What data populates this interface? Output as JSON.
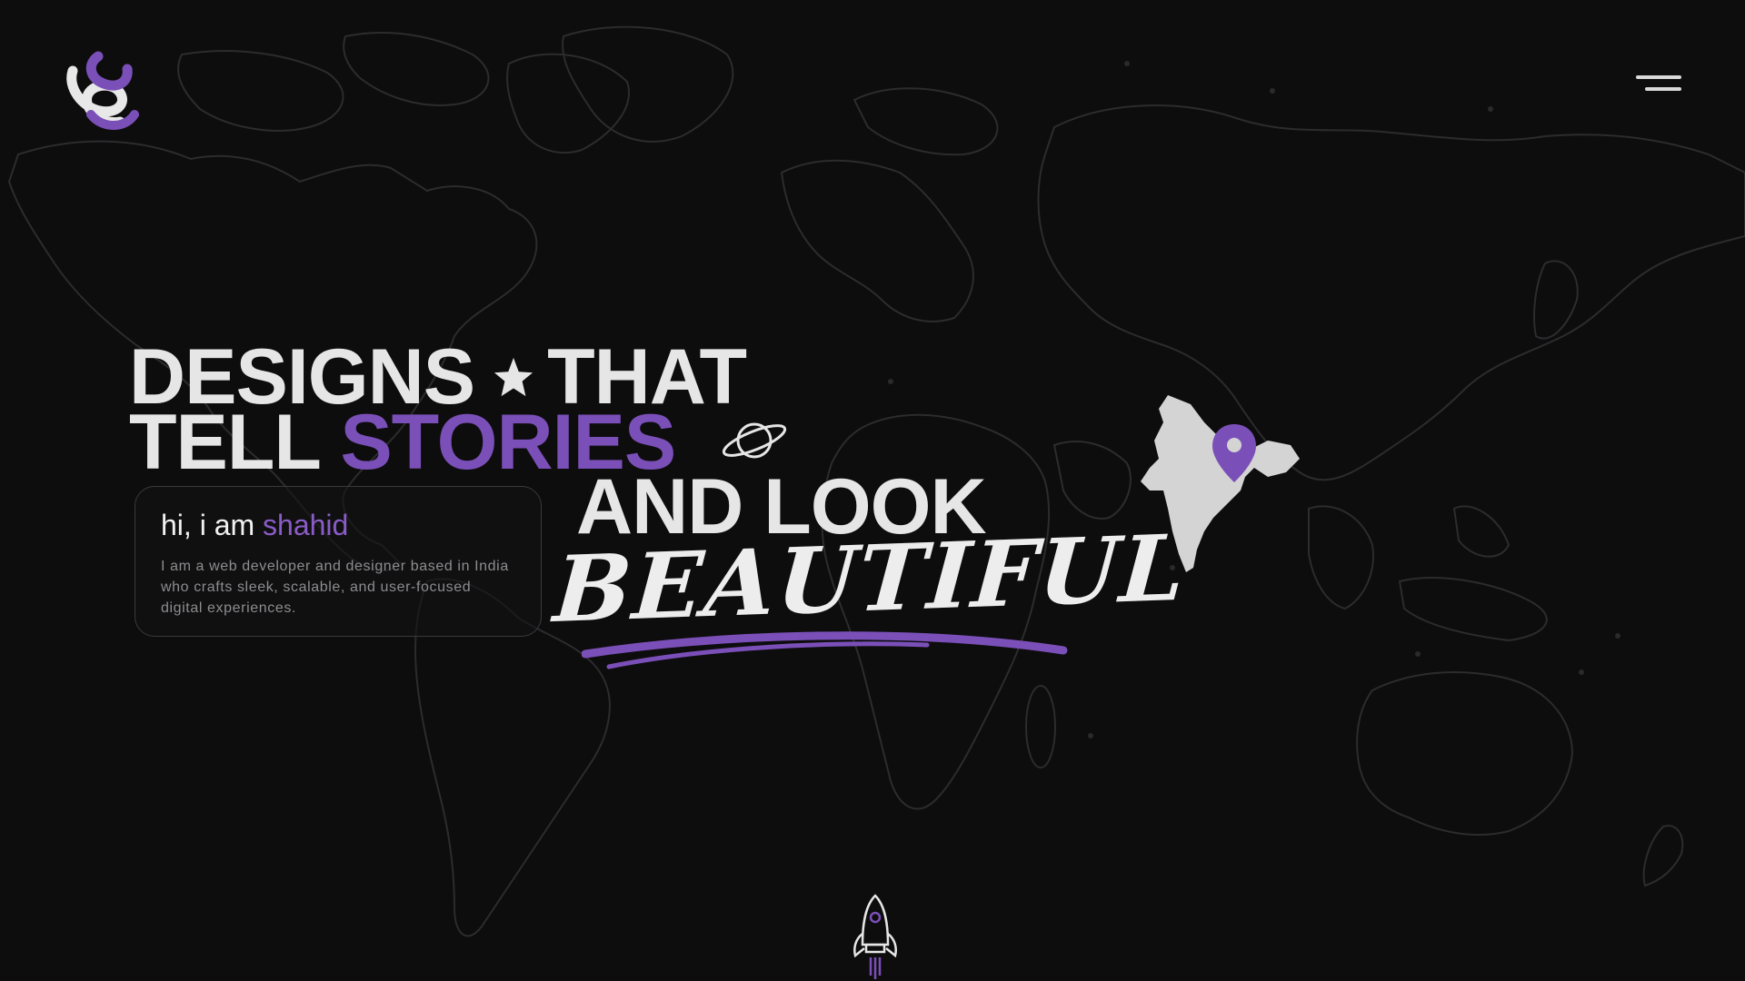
{
  "brand": {
    "logo_icon": "swirl-logo-icon",
    "colors": {
      "accent": "#7b4fb8",
      "text": "#e6e6e6",
      "background": "#0d0d0e",
      "muted": "#8d8d90"
    }
  },
  "nav": {
    "menu_icon": "hamburger-menu-icon"
  },
  "hero": {
    "line1_part1": "DESIGNS",
    "line1_part2": "THAT",
    "line2_part1": "TELL",
    "line2_highlight": "STORIES",
    "line3": "AND LOOK",
    "script_word": "BEAUTIFUL",
    "decorations": [
      "star-icon",
      "planet-icon",
      "brush-underline"
    ]
  },
  "intro": {
    "greeting_prefix": "hi, i am",
    "name": "shahid",
    "description": "I am a web developer and designer based in India who crafts sleek, scalable, and user-focused digital experiences."
  },
  "map": {
    "background_icon": "world-map-outline",
    "highlight_icon": "india-map-icon",
    "pin_icon": "location-pin-icon"
  },
  "scroll": {
    "icon": "rocket-icon"
  }
}
